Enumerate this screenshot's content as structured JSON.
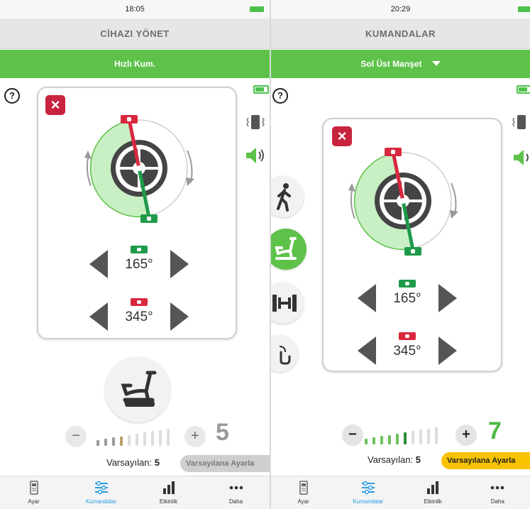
{
  "screens": [
    {
      "status": {
        "time": "18:05"
      },
      "title": "CİHAZI YÖNET",
      "subheader": {
        "label": "Hızlı Kum."
      },
      "help_label": "?",
      "steppers": [
        {
          "value": "165°",
          "chip": "green"
        },
        {
          "value": "345°",
          "chip": "red"
        }
      ],
      "level": {
        "minus_label": "−",
        "plus_label": "+",
        "value": "5",
        "bars_total": 10,
        "bars_active": 4
      },
      "default_row": {
        "label_prefix": "Varsayılan:",
        "label_value": "5",
        "reset_label": "Varsayılana Ayarla"
      }
    },
    {
      "status": {
        "time": "20:29"
      },
      "title": "KUMANDALAR",
      "subheader": {
        "label": "Sol Üst Manşet"
      },
      "help_label": "?",
      "steppers": [
        {
          "value": "165°",
          "chip": "green"
        },
        {
          "value": "345°",
          "chip": "red"
        }
      ],
      "modes": [
        {
          "name": "walk",
          "active": false
        },
        {
          "name": "bike",
          "active": true
        },
        {
          "name": "weights",
          "active": false
        },
        {
          "name": "touch",
          "active": false
        }
      ],
      "level": {
        "minus_label": "−",
        "plus_label": "+",
        "value": "7",
        "bars_total": 10,
        "bars_active": 6
      },
      "default_row": {
        "label_prefix": "Varsayılan:",
        "label_value": "5",
        "reset_label": "Varsayılana Ayarla"
      }
    }
  ],
  "tabs": [
    {
      "label": "Ayar",
      "icon": "settings-device-icon",
      "active": false
    },
    {
      "label": "Kumandalar",
      "icon": "sliders-icon",
      "active": true
    },
    {
      "label": "Etkinlik",
      "icon": "bar-chart-icon",
      "active": false
    },
    {
      "label": "Daha",
      "icon": "more-dots-icon",
      "active": false
    }
  ],
  "colors": {
    "green": "#5ec24a",
    "dark_green": "#1f9a4a",
    "red": "#d9283e",
    "close_red": "#c9243f",
    "yellow": "#f7c300",
    "tab_active": "#2a9de0"
  }
}
